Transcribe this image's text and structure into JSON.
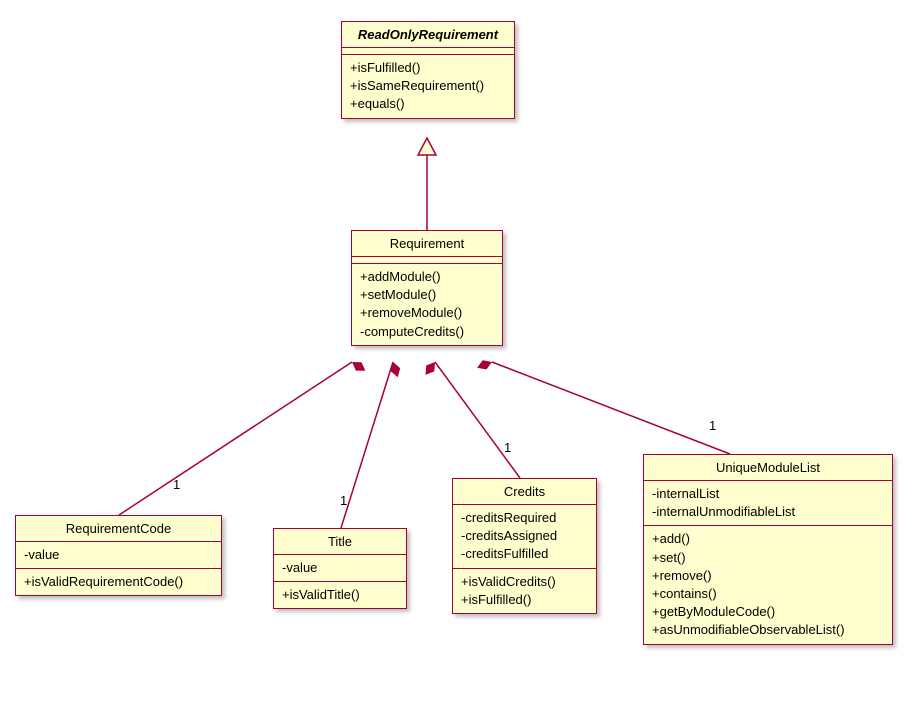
{
  "classes": {
    "rori": {
      "name": "ReadOnlyRequirement",
      "attrs": [],
      "ops": [
        "+isFulfilled()",
        "+isSameRequirement()",
        "+equals()"
      ]
    },
    "req": {
      "name": "Requirement",
      "attrs": [],
      "ops": [
        "+addModule()",
        "+setModule()",
        "+removeModule()",
        "-computeCredits()"
      ]
    },
    "rcode": {
      "name": "RequirementCode",
      "attrs": [
        "-value"
      ],
      "ops": [
        "+isValidRequirementCode()"
      ]
    },
    "title": {
      "name": "Title",
      "attrs": [
        "-value"
      ],
      "ops": [
        "+isValidTitle()"
      ]
    },
    "credits": {
      "name": "Credits",
      "attrs": [
        "-creditsRequired",
        "-creditsAssigned",
        "-creditsFulfilled"
      ],
      "ops": [
        "+isValidCredits()",
        "+isFulfilled()"
      ]
    },
    "uml": {
      "name": "UniqueModuleList",
      "attrs": [
        "-internalList",
        "-internalUnmodifiableList"
      ],
      "ops": [
        "+add()",
        "+set()",
        "+remove()",
        "+contains()",
        "+getByModuleCode()",
        "+asUnmodifiableObservableList()"
      ]
    }
  },
  "mult": {
    "rcode": "1",
    "title": "1",
    "credits": "1",
    "uml": "1"
  }
}
